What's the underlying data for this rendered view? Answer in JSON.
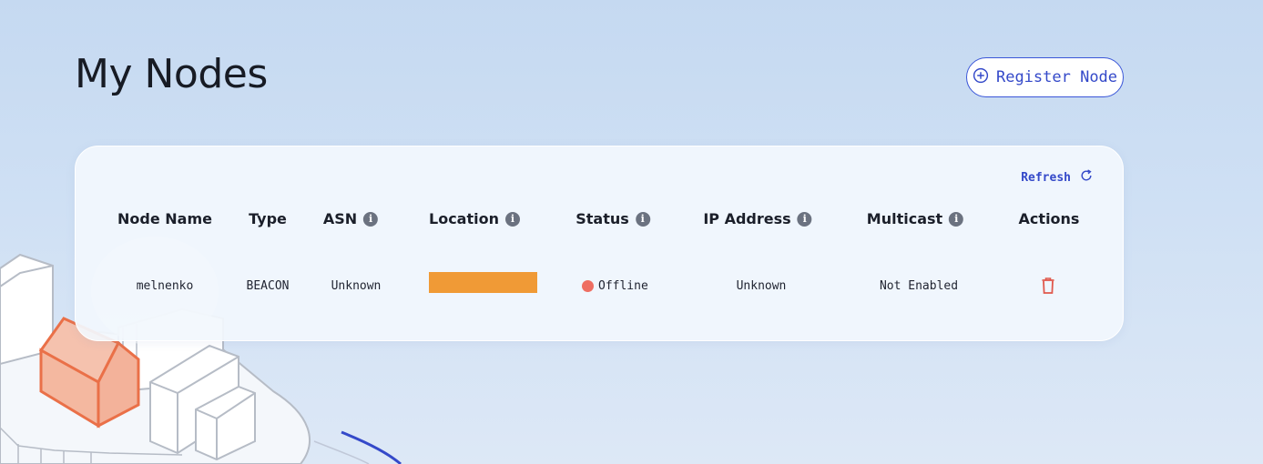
{
  "page": {
    "title": "My Nodes",
    "register_label": "Register Node"
  },
  "card": {
    "refresh_label": "Refresh",
    "columns": {
      "node_name": "Node Name",
      "type": "Type",
      "asn": "ASN",
      "location": "Location",
      "status": "Status",
      "ip_address": "IP Address",
      "multicast": "Multicast",
      "actions": "Actions"
    },
    "row": {
      "node_name": "melnenko",
      "type": "BEACON",
      "asn": "Unknown",
      "status": "Offline",
      "ip_address": "Unknown",
      "multicast": "Not Enabled"
    }
  },
  "icons": {
    "register": "plus-circle-icon",
    "refresh": "refresh-icon",
    "info": "info-icon",
    "delete": "trash-icon",
    "status": "status-dot"
  },
  "colors": {
    "accent": "#3449c9",
    "location_bar": "#f09a36",
    "offline": "#ee6e62",
    "delete": "#e0584c"
  }
}
